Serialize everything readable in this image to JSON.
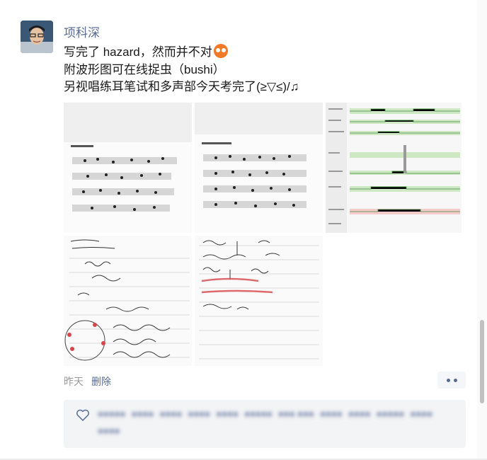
{
  "post": {
    "author": "项科深",
    "lines": [
      "写完了 hazard，然而并不对",
      "附波形图可在线捉虫（bushi）",
      "另视唱练耳笔试和多声部今天考完了(≥▽≤)/♫"
    ],
    "emoji_icon": "sweat-face-emoji",
    "images": [
      {
        "name": "ear-training-sheet-1",
        "kind": "score"
      },
      {
        "name": "ear-training-sheet-2",
        "kind": "score"
      },
      {
        "name": "waveform-screenshot",
        "kind": "waveform"
      },
      {
        "name": "handwritten-score-1",
        "kind": "handwritten"
      },
      {
        "name": "handwritten-score-2",
        "kind": "handwritten"
      }
    ],
    "time": "昨天",
    "delete_label": "删除"
  },
  "likes": {
    "icon": "heart-icon",
    "names": [
      "●●●●●",
      "●●●●",
      "●●●●",
      "●●●●",
      "●●●●",
      "●●●●●",
      "●●● ●●●",
      "●●●●",
      "●●●●",
      "●●●●●",
      "●●●●",
      "●●●●"
    ]
  },
  "colors": {
    "link": "#576b95",
    "meta_gray": "#9a9a9a",
    "likes_bg": "#f3f4f6"
  }
}
